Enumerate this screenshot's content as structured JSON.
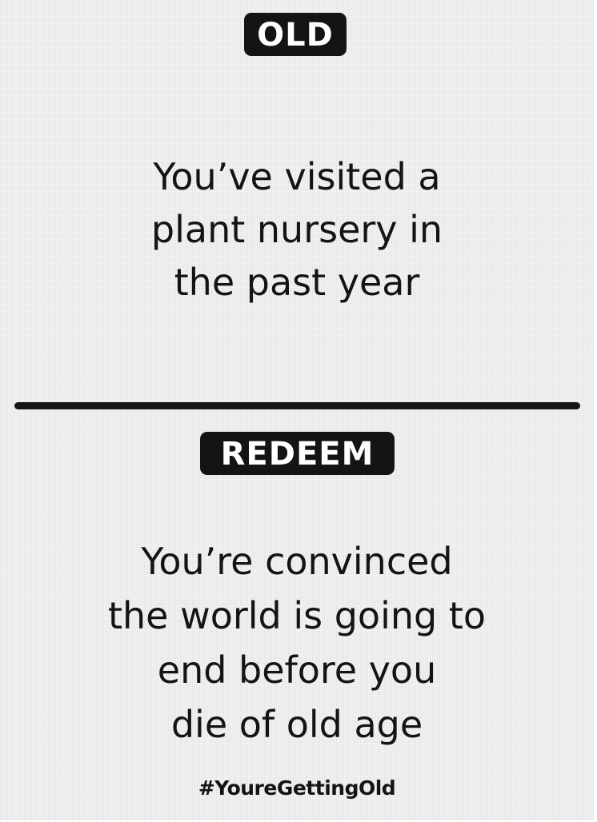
{
  "card": {
    "top_section": {
      "label": "OLD",
      "text": "You’ve visited a\nplant nursery in\nthe past year"
    },
    "bottom_section": {
      "label": "REDEEM",
      "text": "You’re convinced\nthe world is going to\nend before you\ndie of old age"
    },
    "footer": {
      "hashtag": "#YoureGettingOld"
    }
  },
  "colors": {
    "card_background": "#eeeeef",
    "ink": "#141414",
    "label_text": "#ffffff"
  }
}
